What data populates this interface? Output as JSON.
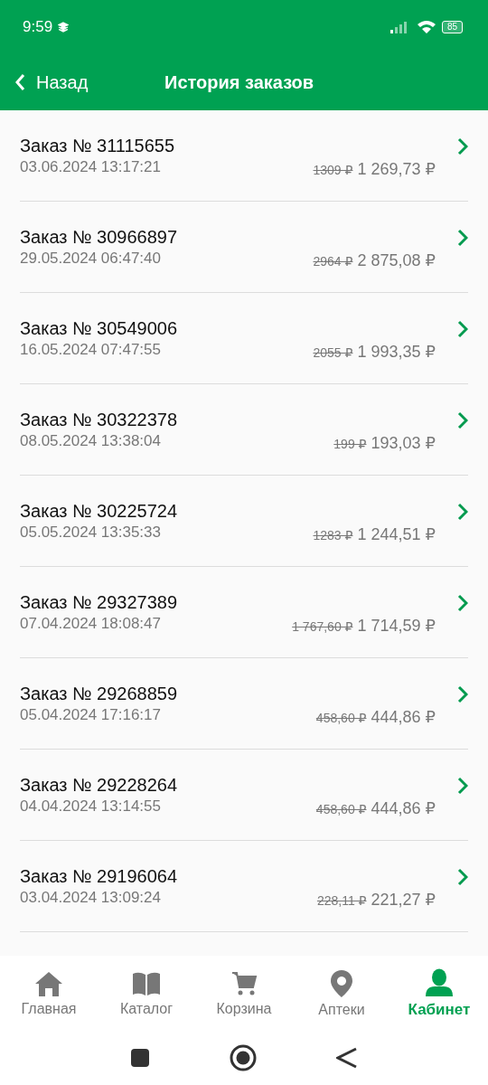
{
  "status_bar": {
    "time": "9:59",
    "battery": "85"
  },
  "header": {
    "back": "Назад",
    "title": "История заказов"
  },
  "orders": [
    {
      "title": "Заказ № 31115655",
      "date": "03.06.2024 13:17:21",
      "old_price": "1309 ₽",
      "price": "1 269,73 ₽"
    },
    {
      "title": "Заказ № 30966897",
      "date": "29.05.2024 06:47:40",
      "old_price": "2964 ₽",
      "price": "2 875,08 ₽"
    },
    {
      "title": "Заказ № 30549006",
      "date": "16.05.2024 07:47:55",
      "old_price": "2055 ₽",
      "price": "1 993,35 ₽"
    },
    {
      "title": "Заказ № 30322378",
      "date": "08.05.2024 13:38:04",
      "old_price": "199 ₽",
      "price": "193,03 ₽"
    },
    {
      "title": "Заказ № 30225724",
      "date": "05.05.2024 13:35:33",
      "old_price": "1283 ₽",
      "price": "1 244,51 ₽"
    },
    {
      "title": "Заказ № 29327389",
      "date": "07.04.2024 18:08:47",
      "old_price": "1 767,60 ₽",
      "price": "1 714,59 ₽"
    },
    {
      "title": "Заказ № 29268859",
      "date": "05.04.2024 17:16:17",
      "old_price": "458,60 ₽",
      "price": "444,86 ₽"
    },
    {
      "title": "Заказ № 29228264",
      "date": "04.04.2024 13:14:55",
      "old_price": "458,60 ₽",
      "price": "444,86 ₽"
    },
    {
      "title": "Заказ № 29196064",
      "date": "03.04.2024 13:09:24",
      "old_price": "228,11 ₽",
      "price": "221,27 ₽"
    }
  ],
  "bottom_nav": [
    {
      "kind": "home",
      "label": "Главная",
      "selected": false
    },
    {
      "kind": "catalog",
      "label": "Каталог",
      "selected": false
    },
    {
      "kind": "cart",
      "label": "Корзина",
      "selected": false
    },
    {
      "kind": "pharmacies",
      "label": "Аптеки",
      "selected": false
    },
    {
      "kind": "account",
      "label": "Кабинет",
      "selected": true
    }
  ]
}
